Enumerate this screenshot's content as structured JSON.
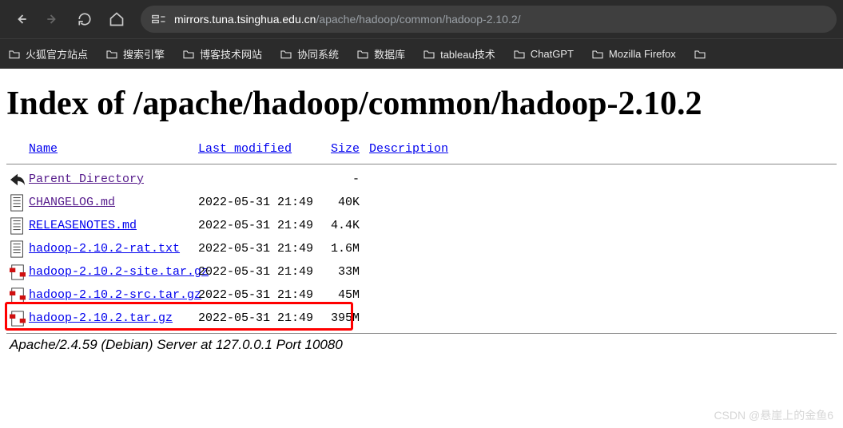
{
  "browser": {
    "url_host": "mirrors.tuna.tsinghua.edu.cn",
    "url_path": "/apache/hadoop/common/hadoop-2.10.2/",
    "bookmarks": [
      {
        "label": "火狐官方站点",
        "icon": "folder"
      },
      {
        "label": "搜索引擎",
        "icon": "folder"
      },
      {
        "label": "博客技术网站",
        "icon": "folder"
      },
      {
        "label": "协同系统",
        "icon": "folder"
      },
      {
        "label": "数据库",
        "icon": "folder"
      },
      {
        "label": "tableau技术",
        "icon": "folder"
      },
      {
        "label": "ChatGPT",
        "icon": "folder"
      },
      {
        "label": "Mozilla Firefox",
        "icon": "folder"
      },
      {
        "label": "",
        "icon": "folder"
      }
    ]
  },
  "page": {
    "title": "Index of /apache/hadoop/common/hadoop-2.10.2",
    "headers": {
      "name": "Name",
      "modified": "Last modified",
      "size": "Size",
      "desc": "Description"
    },
    "parent": {
      "name": "Parent Directory",
      "size": "-"
    },
    "files": [
      {
        "name": "CHANGELOG.md",
        "modified": "2022-05-31 21:49",
        "size": "40K",
        "icon": "text",
        "visited": true
      },
      {
        "name": "RELEASENOTES.md",
        "modified": "2022-05-31 21:49",
        "size": "4.4K",
        "icon": "text",
        "visited": false
      },
      {
        "name": "hadoop-2.10.2-rat.txt",
        "modified": "2022-05-31 21:49",
        "size": "1.6M",
        "icon": "text",
        "visited": false
      },
      {
        "name": "hadoop-2.10.2-site.tar.gz",
        "modified": "2022-05-31 21:49",
        "size": "33M",
        "icon": "archive",
        "visited": false
      },
      {
        "name": "hadoop-2.10.2-src.tar.gz",
        "modified": "2022-05-31 21:49",
        "size": "45M",
        "icon": "archive",
        "visited": false
      },
      {
        "name": "hadoop-2.10.2.tar.gz",
        "modified": "2022-05-31 21:49",
        "size": "395M",
        "icon": "archive",
        "visited": false,
        "highlight": true
      }
    ],
    "server_sig": "Apache/2.4.59 (Debian) Server at 127.0.0.1 Port 10080"
  },
  "watermark": "CSDN @悬崖上的金鱼6"
}
